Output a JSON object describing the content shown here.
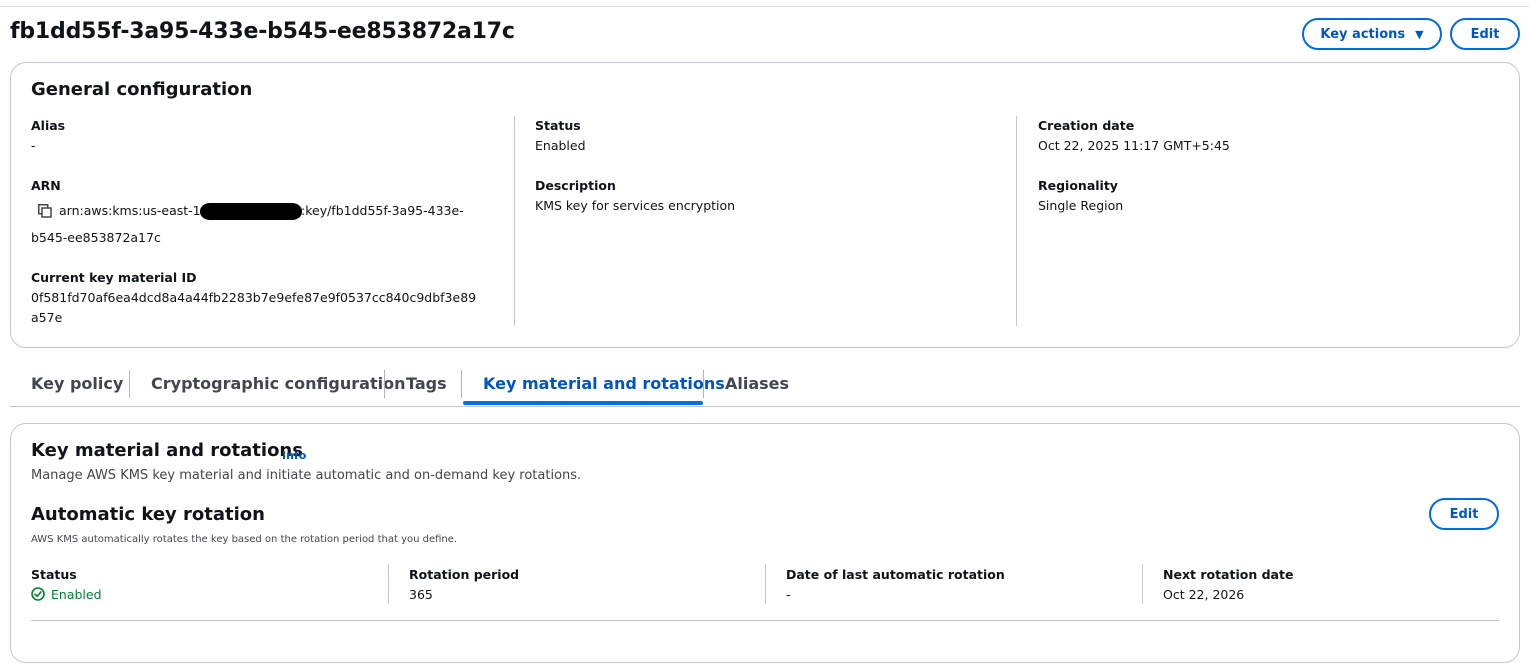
{
  "header": {
    "title": "fb1dd55f-3a95-433e-b545-ee853872a17c",
    "key_actions_label": "Key actions",
    "edit_label": "Edit"
  },
  "general": {
    "title": "General configuration",
    "alias_label": "Alias",
    "alias_value": "-",
    "arn_label": "ARN",
    "arn_prefix": "arn:aws:kms:us-east-1",
    "arn_suffix": ":key/fb1dd55f-3a95-433e-",
    "arn_line2": "b545-ee853872a17c",
    "key_material_label": "Current key material ID",
    "key_material_line1": "0f581fd70af6ea4dcd8a4a44fb2283b7e9efe87e9f0537cc840c9dbf3e89",
    "key_material_line2": "a57e",
    "status_label": "Status",
    "status_value": "Enabled",
    "description_label": "Description",
    "description_value": "KMS key for services encryption",
    "creation_label": "Creation date",
    "creation_value": "Oct 22, 2025 11:17 GMT+5:45",
    "regionality_label": "Regionality",
    "regionality_value": "Single Region"
  },
  "tabs": [
    {
      "label": "Key policy"
    },
    {
      "label": "Cryptographic configuration"
    },
    {
      "label": "Tags"
    },
    {
      "label": "Key material and rotations",
      "active": true
    },
    {
      "label": "Aliases"
    }
  ],
  "rotation_panel": {
    "title": "Key material and rotations",
    "info_label": "Info",
    "description": "Manage AWS KMS key material and initiate automatic and on-demand key rotations.",
    "auto_title": "Automatic key rotation",
    "auto_desc": "AWS KMS automatically rotates the key based on the rotation period that you define.",
    "edit_label": "Edit",
    "status_label": "Status",
    "status_value": "Enabled",
    "period_label": "Rotation period",
    "period_value": "365",
    "last_label": "Date of last automatic rotation",
    "last_value": "-",
    "next_label": "Next rotation date",
    "next_value": "Oct 22, 2026"
  },
  "colors": {
    "accent": "#0055c2",
    "tab_underline": "#0072e0",
    "success": "#00802f"
  },
  "icons": [
    "copy-icon",
    "caret-down-icon",
    "status-ok-icon"
  ]
}
